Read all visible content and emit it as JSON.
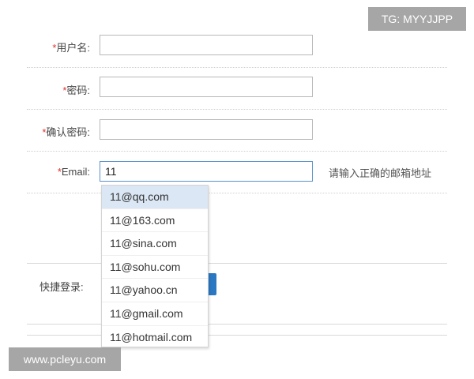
{
  "form": {
    "required_mark": "*",
    "username": {
      "label": "用户名:",
      "value": ""
    },
    "password": {
      "label": "密码:",
      "value": ""
    },
    "confirm_password": {
      "label": "确认密码:",
      "value": ""
    },
    "email": {
      "label": "Email:",
      "value": "11",
      "hint": "请输入正确的邮箱地址"
    },
    "quick_login_label": "快捷登录:"
  },
  "email_suggestions": {
    "selected_index": 0,
    "items": [
      "11@qq.com",
      "11@163.com",
      "11@sina.com",
      "11@sohu.com",
      "11@yahoo.cn",
      "11@gmail.com",
      "11@hotmail.com"
    ]
  },
  "watermarks": {
    "top_right": "TG: MYYJJPP",
    "bottom_left": "www.pcleyu.com"
  },
  "colors": {
    "required": "#e0302c",
    "focus_border": "#5a93c9",
    "selected_item_bg": "#dbe7f4",
    "button_blue": "#2b78c2"
  }
}
